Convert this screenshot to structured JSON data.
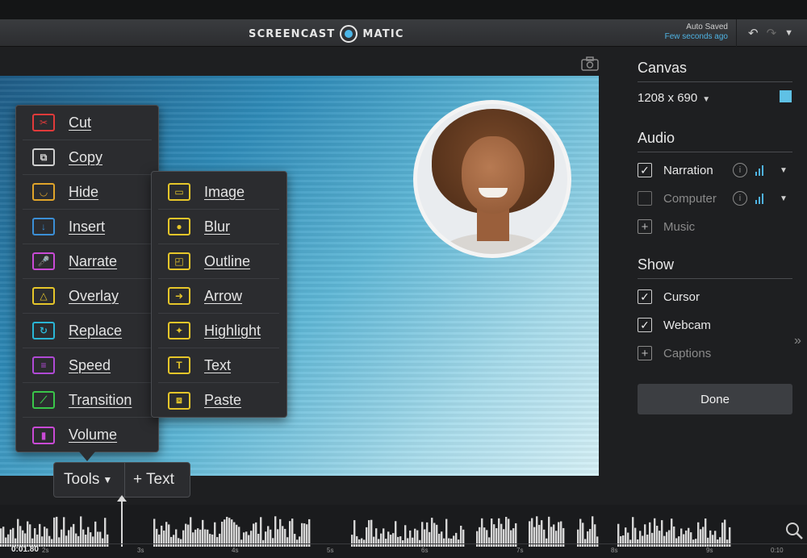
{
  "app": {
    "brand_left": "SCREENCAST",
    "brand_right": "MATIC",
    "saved_line1": "Auto Saved",
    "saved_line2": "Few seconds ago"
  },
  "tools_menu": [
    {
      "label": "Cut",
      "icon": "scissors-icon",
      "color": "#e23a3a",
      "glyph": "✂"
    },
    {
      "label": "Copy",
      "icon": "copy-icon",
      "color": "#d0d0d0",
      "glyph": "⧉"
    },
    {
      "label": "Hide",
      "icon": "hide-icon",
      "color": "#e0a42a",
      "glyph": "◡"
    },
    {
      "label": "Insert",
      "icon": "insert-icon",
      "color": "#3b8fd6",
      "glyph": "↓"
    },
    {
      "label": "Narrate",
      "icon": "microphone-icon",
      "color": "#c94ad6",
      "glyph": "🎤"
    },
    {
      "label": "Overlay",
      "icon": "overlay-icon",
      "color": "#e6c62a",
      "glyph": "△"
    },
    {
      "label": "Replace",
      "icon": "replace-icon",
      "color": "#2ab6d6",
      "glyph": "↻"
    },
    {
      "label": "Speed",
      "icon": "speed-icon",
      "color": "#b04ad6",
      "glyph": "≡"
    },
    {
      "label": "Transition",
      "icon": "transition-icon",
      "color": "#3ac64a",
      "glyph": "⟋"
    },
    {
      "label": "Volume",
      "icon": "volume-icon",
      "color": "#c94ad6",
      "glyph": "▮"
    }
  ],
  "overlay_menu": [
    {
      "label": "Image",
      "icon": "image-icon",
      "color": "#e6c62a",
      "glyph": "▭"
    },
    {
      "label": "Blur",
      "icon": "blur-icon",
      "color": "#e6c62a",
      "glyph": "●"
    },
    {
      "label": "Outline",
      "icon": "outline-icon",
      "color": "#e6c62a",
      "glyph": "◰"
    },
    {
      "label": "Arrow",
      "icon": "arrow-icon",
      "color": "#e6c62a",
      "glyph": "➜"
    },
    {
      "label": "Highlight",
      "icon": "highlight-icon",
      "color": "#e6c62a",
      "glyph": "✦"
    },
    {
      "label": "Text",
      "icon": "text-icon",
      "color": "#e6c62a",
      "glyph": "T"
    },
    {
      "label": "Paste",
      "icon": "paste-icon",
      "color": "#e6c62a",
      "glyph": "⧈"
    }
  ],
  "toolbar": {
    "tools_label": "Tools",
    "add_text_label": "+ Text"
  },
  "side": {
    "canvas_title": "Canvas",
    "canvas_size": "1208 x 690",
    "canvas_color": "#5fc1e5",
    "audio_title": "Audio",
    "narration_label": "Narration",
    "computer_label": "Computer",
    "music_label": "Music",
    "show_title": "Show",
    "cursor_label": "Cursor",
    "webcam_label": "Webcam",
    "captions_label": "Captions",
    "done_label": "Done"
  },
  "timeline": {
    "current_time": "0:01.80",
    "ticks": [
      "2s",
      "3s",
      "4s",
      "5s",
      "6s",
      "7s",
      "8s",
      "9s",
      "0:10"
    ]
  }
}
